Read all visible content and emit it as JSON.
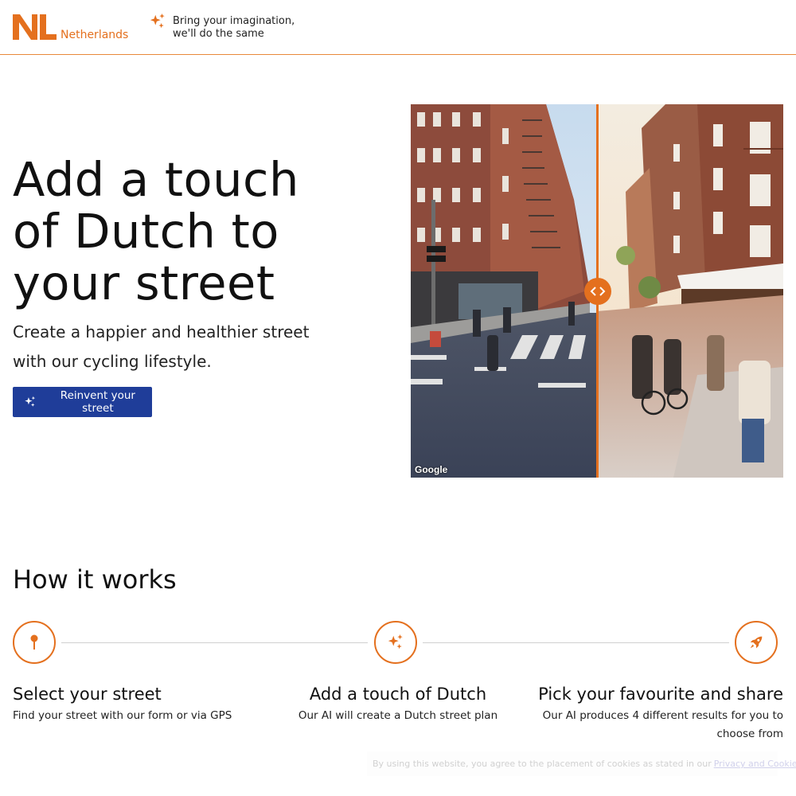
{
  "header": {
    "logo_text": "Netherlands",
    "tagline_line1": "Bring your imagination,",
    "tagline_line2": "we'll do the same"
  },
  "hero": {
    "title_line1": "Add a touch",
    "title_line2": "of Dutch to",
    "title_line3": "your street",
    "subtitle_line1": "Create a happier and healthier street",
    "subtitle_line2": "with our cycling lifestyle.",
    "cta_label": "Reinvent your street",
    "image_credit": "Google"
  },
  "how_it_works": {
    "title": "How it works",
    "steps": [
      {
        "icon": "map-pin-icon",
        "title": "Select your street",
        "description": "Find your street with our form or via GPS"
      },
      {
        "icon": "sparkles-icon",
        "title": "Add a touch of Dutch",
        "description": "Our AI will create a Dutch street plan"
      },
      {
        "icon": "rocket-icon",
        "title": "Pick your favourite and share",
        "description_line1": "Our AI produces 4 different results for you to",
        "description_line2": "choose from"
      }
    ]
  },
  "cookie_notice": {
    "text": "By using this website, you agree to the placement of cookies as stated in our",
    "link_label": "Privacy and Cookie policy",
    "suffix": "."
  },
  "colors": {
    "accent_orange": "#e4701e",
    "cta_blue": "#1f3d99",
    "header_border": "#e8893a"
  }
}
